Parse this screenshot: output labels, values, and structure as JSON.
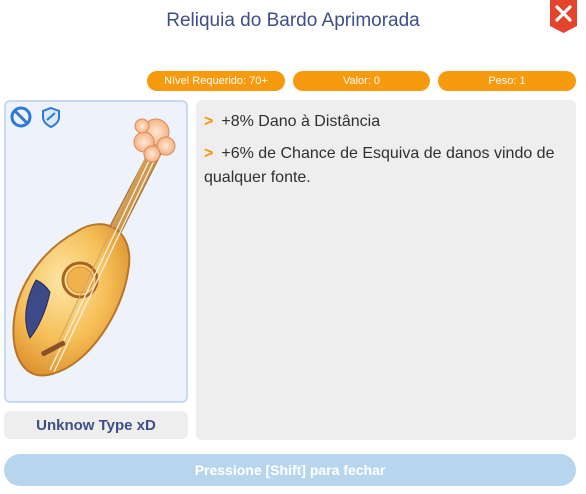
{
  "window": {
    "title": "Reliquia do Bardo Aprimorada"
  },
  "stats": {
    "required_level": "Nível Requerido: 70+",
    "value": "Valor: 0",
    "weight": "Peso: 1"
  },
  "item": {
    "type_label": "Unknow Type xD",
    "icons": [
      "no-slot-icon",
      "shield-icon",
      "mandolin-item-icon"
    ]
  },
  "description": {
    "bullet": ">",
    "lines": [
      "+8% Dano à Distância",
      "+6% de Chance de Esquiva de danos vindo de qualquer fonte."
    ]
  },
  "footer": {
    "close_hint": "Pressione [Shift] para fechar"
  },
  "colors": {
    "title": "#3f4f86",
    "accent_orange": "#f79a0d",
    "close_red": "#e2452b",
    "footer_bar": "#b7d6ee"
  }
}
